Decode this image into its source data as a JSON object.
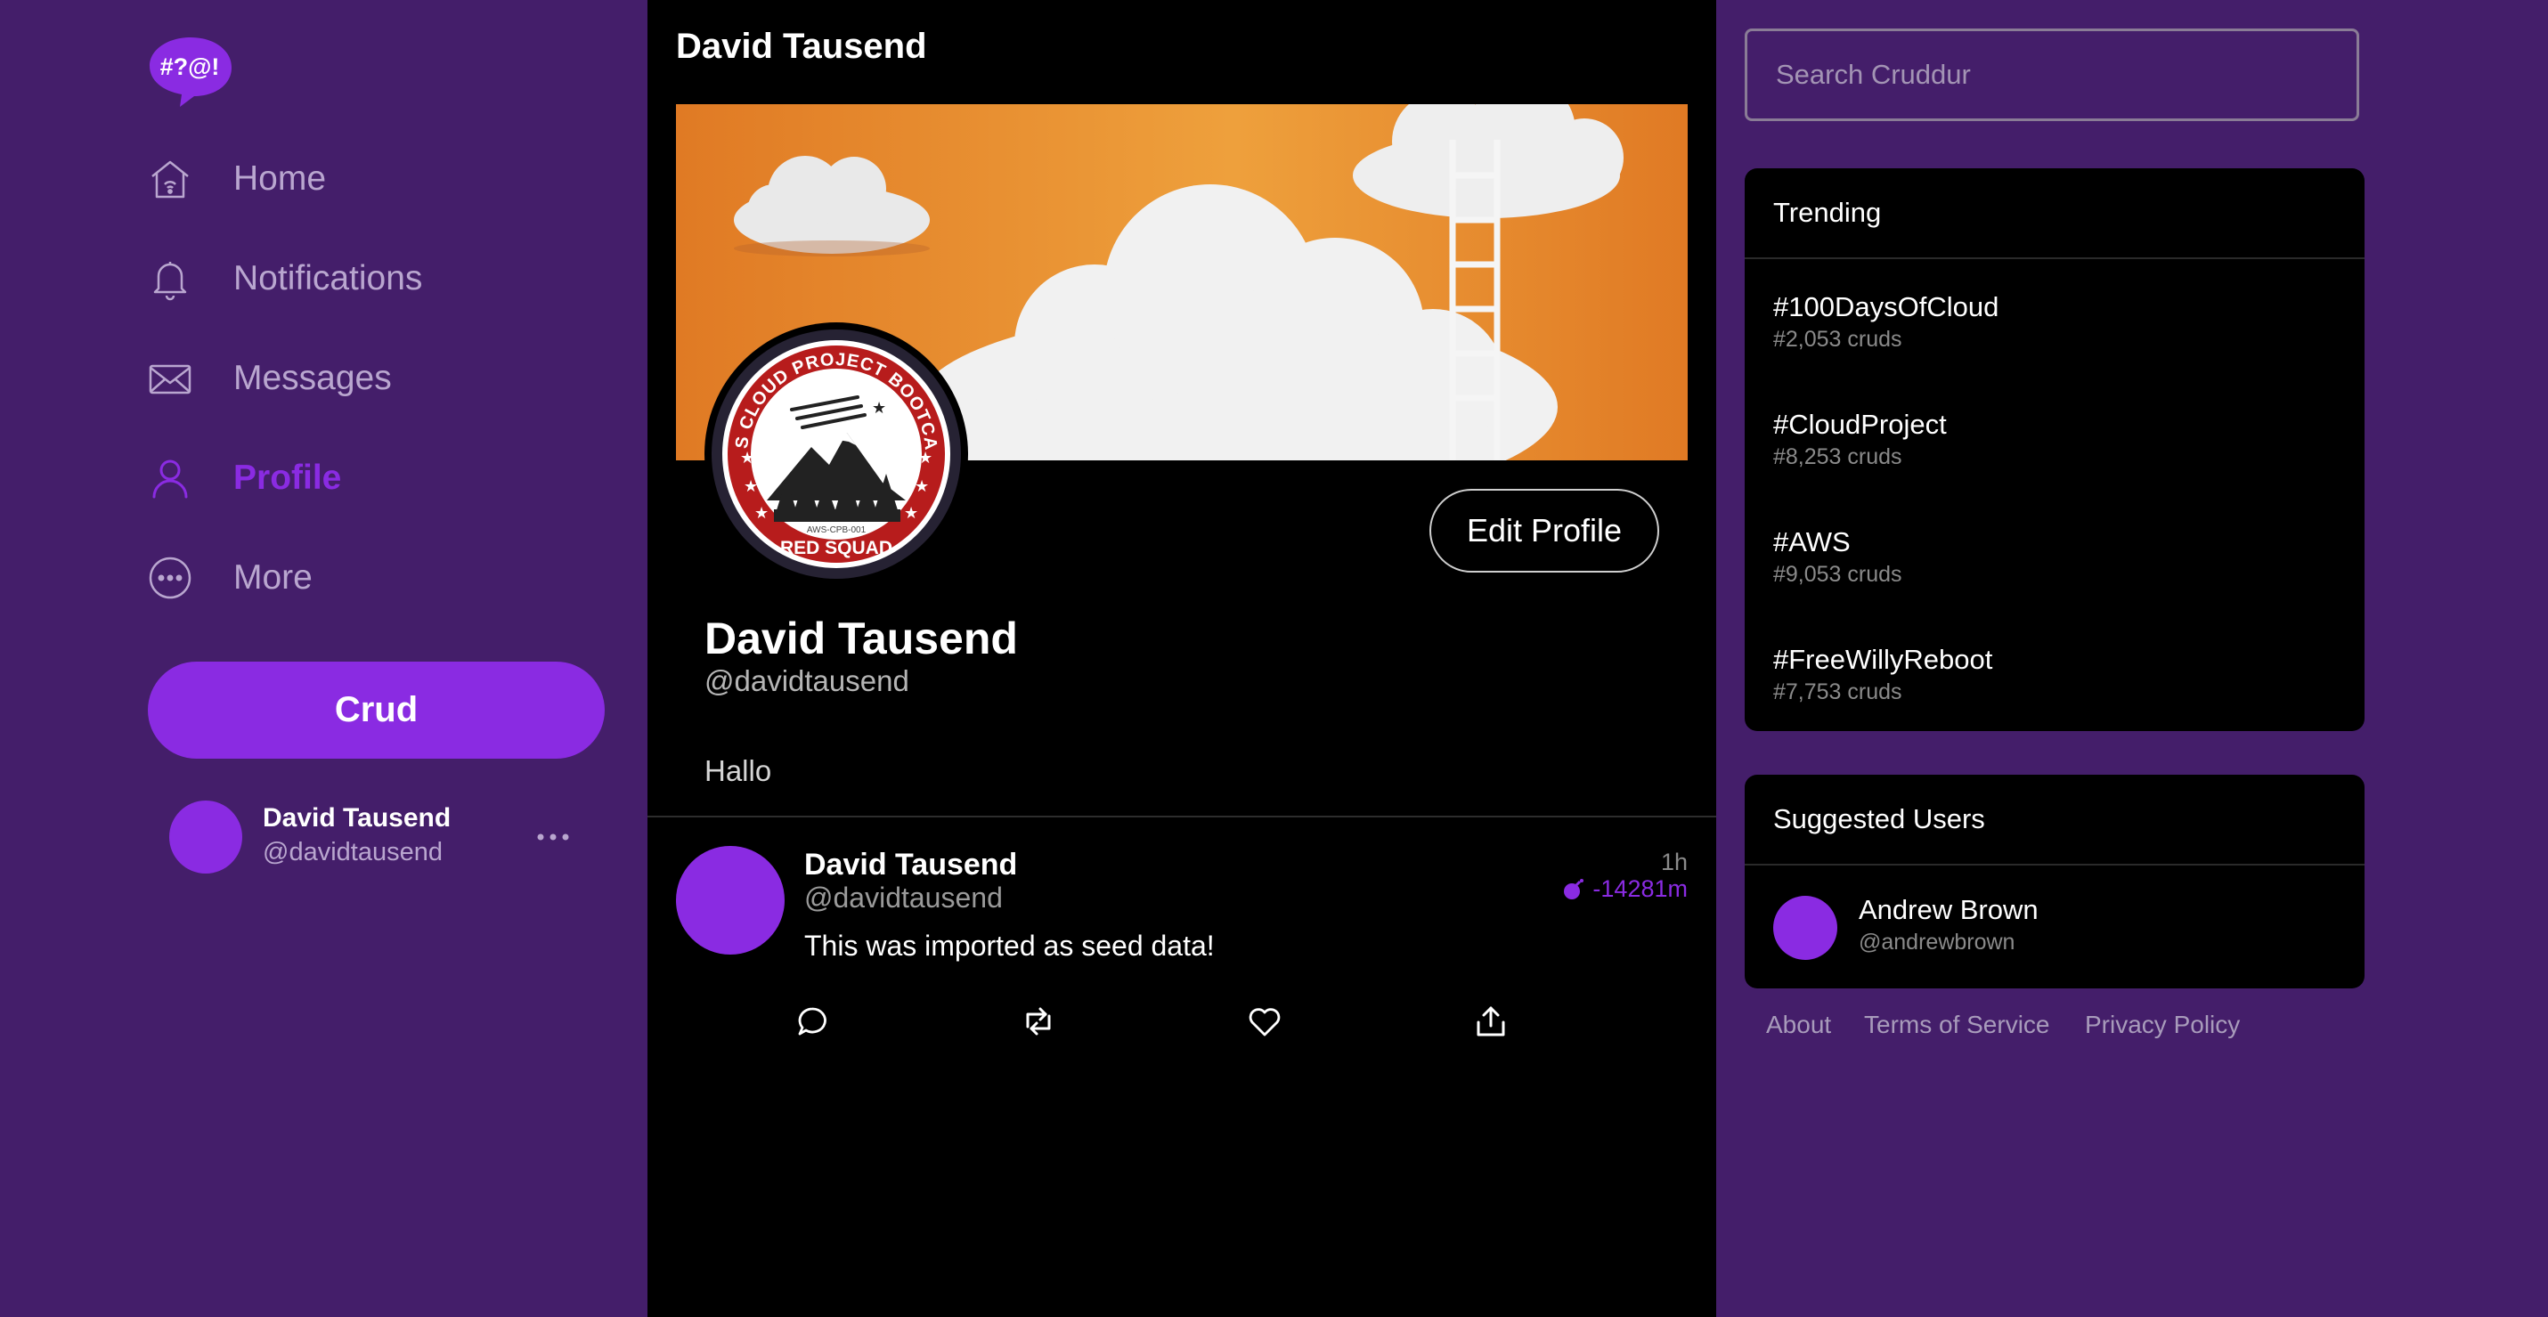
{
  "app": {
    "logo_text": "#?@!"
  },
  "nav": {
    "items": [
      {
        "label": "Home",
        "icon": "home-icon",
        "active": false
      },
      {
        "label": "Notifications",
        "icon": "bell-icon",
        "active": false
      },
      {
        "label": "Messages",
        "icon": "envelope-icon",
        "active": false
      },
      {
        "label": "Profile",
        "icon": "person-icon",
        "active": true
      },
      {
        "label": "More",
        "icon": "more-circle-icon",
        "active": false
      }
    ],
    "crud_label": "Crud",
    "account": {
      "name": "David Tausend",
      "handle": "@davidtausend"
    }
  },
  "main": {
    "title": "David Tausend",
    "badge": {
      "top_text": "AWS CLOUD PROJECT BOOTCAMP",
      "bottom_text": "RED SQUAD",
      "code": "AWS-CPB-001"
    },
    "edit_profile_label": "Edit Profile",
    "profile": {
      "name": "David Tausend",
      "handle": "@davidtausend",
      "bio": "Hallo"
    },
    "activity": {
      "name": "David Tausend",
      "handle": "@davidtausend",
      "message": "This was imported as seed data!",
      "time": "1h",
      "expires": "-14281m",
      "actions": [
        "reply-icon",
        "repost-icon",
        "like-icon",
        "share-icon"
      ]
    }
  },
  "sidebar": {
    "search_placeholder": "Search Cruddur",
    "trending_title": "Trending",
    "trending": [
      {
        "tag": "#100DaysOfCloud",
        "count": "#2,053 cruds"
      },
      {
        "tag": "#CloudProject",
        "count": "#8,253 cruds"
      },
      {
        "tag": "#AWS",
        "count": "#9,053 cruds"
      },
      {
        "tag": "#FreeWillyReboot",
        "count": "#7,753 cruds"
      }
    ],
    "suggested_title": "Suggested Users",
    "suggested": [
      {
        "name": "Andrew Brown",
        "handle": "@andrewbrown"
      }
    ],
    "footer": [
      "About",
      "Terms of Service",
      "Privacy Policy"
    ]
  },
  "colors": {
    "accent": "#8a2be2",
    "background": "#441e6a",
    "panel": "#000000",
    "banner": "#e58a2c"
  }
}
